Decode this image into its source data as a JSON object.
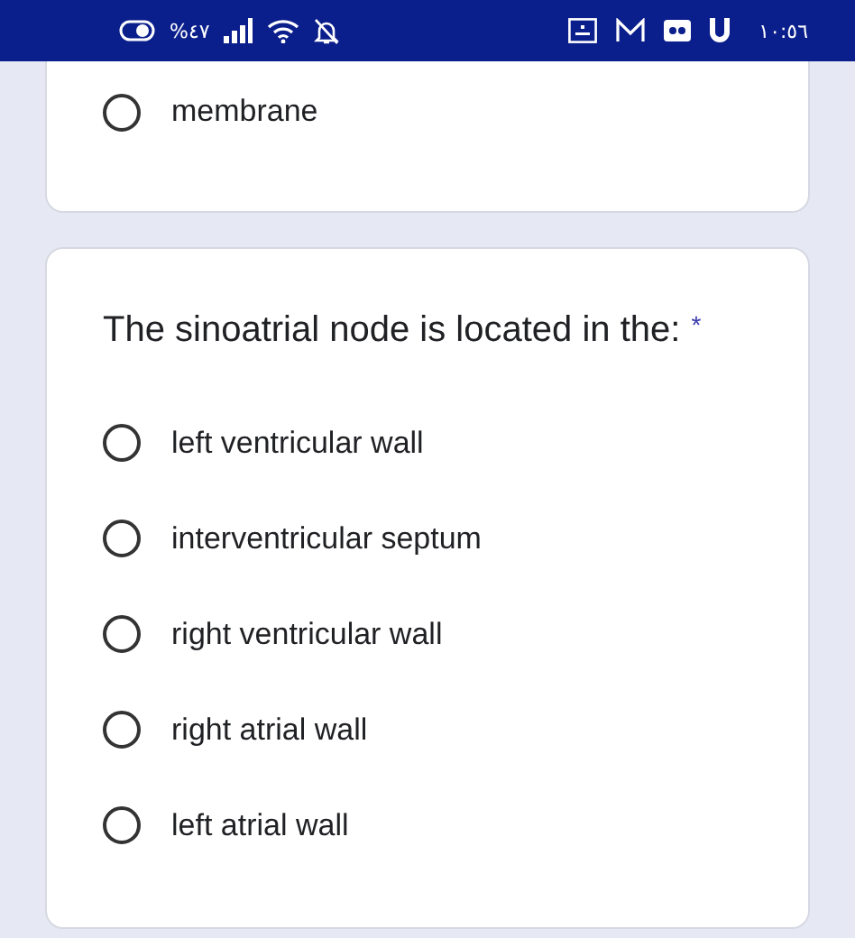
{
  "status_bar": {
    "battery": "%٤٧",
    "time": "١٠:٥٦"
  },
  "previous_question": {
    "options": [
      {
        "label": "membrane",
        "selected": false
      }
    ]
  },
  "question": {
    "title": "The sinoatrial node is located in the:",
    "required_mark": "*",
    "options": [
      {
        "label": "left ventricular wall",
        "selected": false
      },
      {
        "label": "interventricular septum",
        "selected": false
      },
      {
        "label": "right ventricular wall",
        "selected": false
      },
      {
        "label": "right atrial wall",
        "selected": false
      },
      {
        "label": "left atrial wall",
        "selected": false
      }
    ]
  }
}
